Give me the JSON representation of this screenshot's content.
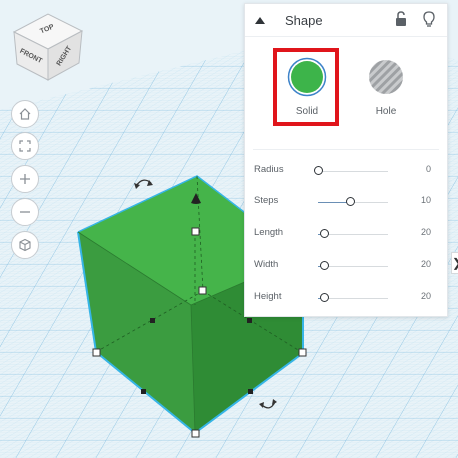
{
  "viewcube": {
    "top_label": "TOP",
    "front_label": "FRONT",
    "right_label": "RIGHT"
  },
  "nav": {
    "home_icon": "home-icon",
    "fit_icon": "fit-view-icon",
    "zoom_in_icon": "plus-icon",
    "zoom_out_icon": "minus-icon",
    "ortho_icon": "cube-icon"
  },
  "shape_panel": {
    "title": "Shape",
    "solid_label": "Solid",
    "hole_label": "Hole",
    "solid_color": "#3db44a",
    "highlight_color": "#e0151b",
    "params": [
      {
        "label": "Radius",
        "value": "0",
        "fraction": 0.0
      },
      {
        "label": "Steps",
        "value": "10",
        "fraction": 0.45
      },
      {
        "label": "Length",
        "value": "20",
        "fraction": 0.08
      },
      {
        "label": "Width",
        "value": "20",
        "fraction": 0.08
      },
      {
        "label": "Height",
        "value": "20",
        "fraction": 0.08
      }
    ]
  },
  "colors": {
    "grid_line": "#b8dbef",
    "grid_bg": "#e9f3f8",
    "box_top": "#45b34a",
    "box_side_left": "#3a9a3f",
    "box_side_right": "#2f8c35",
    "box_outline": "#2fb3e6"
  }
}
